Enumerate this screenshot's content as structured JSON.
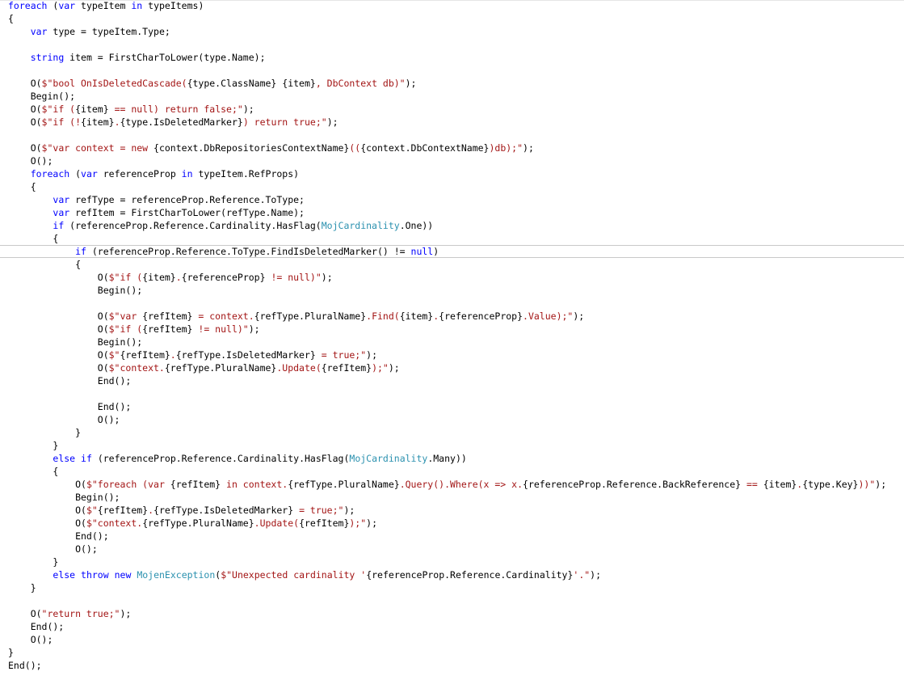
{
  "lines": [
    {
      "tokens": [
        {
          "t": "foreach",
          "c": "kw"
        },
        {
          "t": " (",
          "c": "pl"
        },
        {
          "t": "var",
          "c": "kw"
        },
        {
          "t": " typeItem ",
          "c": "pl"
        },
        {
          "t": "in",
          "c": "kw"
        },
        {
          "t": " typeItems)",
          "c": "pl"
        }
      ]
    },
    {
      "tokens": [
        {
          "t": "{",
          "c": "pl"
        }
      ]
    },
    {
      "tokens": [
        {
          "t": "    ",
          "c": "pl"
        },
        {
          "t": "var",
          "c": "kw"
        },
        {
          "t": " type = typeItem.Type;",
          "c": "pl"
        }
      ]
    },
    {
      "tokens": []
    },
    {
      "tokens": [
        {
          "t": "    ",
          "c": "pl"
        },
        {
          "t": "string",
          "c": "kw"
        },
        {
          "t": " item = FirstCharToLower(type.Name);",
          "c": "pl"
        }
      ]
    },
    {
      "tokens": []
    },
    {
      "tokens": [
        {
          "t": "    O(",
          "c": "pl"
        },
        {
          "t": "$\"bool OnIsDeletedCascade(",
          "c": "str"
        },
        {
          "t": "{type.ClassName}",
          "c": "pl"
        },
        {
          "t": " ",
          "c": "str"
        },
        {
          "t": "{item}",
          "c": "pl"
        },
        {
          "t": ", DbContext db)\"",
          "c": "str"
        },
        {
          "t": ");",
          "c": "pl"
        }
      ]
    },
    {
      "tokens": [
        {
          "t": "    Begin();",
          "c": "pl"
        }
      ]
    },
    {
      "tokens": [
        {
          "t": "    O(",
          "c": "pl"
        },
        {
          "t": "$\"if (",
          "c": "str"
        },
        {
          "t": "{item}",
          "c": "pl"
        },
        {
          "t": " == null) return false;\"",
          "c": "str"
        },
        {
          "t": ");",
          "c": "pl"
        }
      ]
    },
    {
      "tokens": [
        {
          "t": "    O(",
          "c": "pl"
        },
        {
          "t": "$\"if (!",
          "c": "str"
        },
        {
          "t": "{item}",
          "c": "pl"
        },
        {
          "t": ".",
          "c": "str"
        },
        {
          "t": "{type.IsDeletedMarker}",
          "c": "pl"
        },
        {
          "t": ") return true;\"",
          "c": "str"
        },
        {
          "t": ");",
          "c": "pl"
        }
      ]
    },
    {
      "tokens": []
    },
    {
      "tokens": [
        {
          "t": "    O(",
          "c": "pl"
        },
        {
          "t": "$\"var context = new ",
          "c": "str"
        },
        {
          "t": "{context.DbRepositoriesContextName}",
          "c": "pl"
        },
        {
          "t": "((",
          "c": "str"
        },
        {
          "t": "{context.DbContextName}",
          "c": "pl"
        },
        {
          "t": ")db);\"",
          "c": "str"
        },
        {
          "t": ");",
          "c": "pl"
        }
      ]
    },
    {
      "tokens": [
        {
          "t": "    O();",
          "c": "pl"
        }
      ]
    },
    {
      "tokens": [
        {
          "t": "    ",
          "c": "pl"
        },
        {
          "t": "foreach",
          "c": "kw"
        },
        {
          "t": " (",
          "c": "pl"
        },
        {
          "t": "var",
          "c": "kw"
        },
        {
          "t": " referenceProp ",
          "c": "pl"
        },
        {
          "t": "in",
          "c": "kw"
        },
        {
          "t": " typeItem.RefProps)",
          "c": "pl"
        }
      ]
    },
    {
      "tokens": [
        {
          "t": "    {",
          "c": "pl"
        }
      ]
    },
    {
      "tokens": [
        {
          "t": "        ",
          "c": "pl"
        },
        {
          "t": "var",
          "c": "kw"
        },
        {
          "t": " refType = referenceProp.Reference.ToType;",
          "c": "pl"
        }
      ]
    },
    {
      "tokens": [
        {
          "t": "        ",
          "c": "pl"
        },
        {
          "t": "var",
          "c": "kw"
        },
        {
          "t": " refItem = FirstCharToLower(refType.Name);",
          "c": "pl"
        }
      ]
    },
    {
      "tokens": [
        {
          "t": "        ",
          "c": "pl"
        },
        {
          "t": "if",
          "c": "kw"
        },
        {
          "t": " (referenceProp.Reference.Cardinality.HasFlag(",
          "c": "pl"
        },
        {
          "t": "MojCardinality",
          "c": "type"
        },
        {
          "t": ".One))",
          "c": "pl"
        }
      ]
    },
    {
      "tokens": [
        {
          "t": "        {",
          "c": "pl"
        }
      ]
    },
    {
      "tokens": [
        {
          "t": "            ",
          "c": "pl"
        },
        {
          "t": "if",
          "c": "kw"
        },
        {
          "t": " (referenceProp.Reference.ToType.FindIsDeletedMarker() != ",
          "c": "pl"
        },
        {
          "t": "null",
          "c": "kw"
        },
        {
          "t": ")",
          "c": "pl"
        }
      ]
    },
    {
      "tokens": [
        {
          "t": "            {",
          "c": "pl"
        }
      ]
    },
    {
      "tokens": [
        {
          "t": "                O(",
          "c": "pl"
        },
        {
          "t": "$\"if (",
          "c": "str"
        },
        {
          "t": "{item}",
          "c": "pl"
        },
        {
          "t": ".",
          "c": "str"
        },
        {
          "t": "{referenceProp}",
          "c": "pl"
        },
        {
          "t": " != null)\"",
          "c": "str"
        },
        {
          "t": ");",
          "c": "pl"
        }
      ]
    },
    {
      "tokens": [
        {
          "t": "                Begin();",
          "c": "pl"
        }
      ]
    },
    {
      "tokens": []
    },
    {
      "tokens": [
        {
          "t": "                O(",
          "c": "pl"
        },
        {
          "t": "$\"var ",
          "c": "str"
        },
        {
          "t": "{refItem}",
          "c": "pl"
        },
        {
          "t": " = context.",
          "c": "str"
        },
        {
          "t": "{refType.PluralName}",
          "c": "pl"
        },
        {
          "t": ".Find(",
          "c": "str"
        },
        {
          "t": "{item}",
          "c": "pl"
        },
        {
          "t": ".",
          "c": "str"
        },
        {
          "t": "{referenceProp}",
          "c": "pl"
        },
        {
          "t": ".Value);\"",
          "c": "str"
        },
        {
          "t": ");",
          "c": "pl"
        }
      ]
    },
    {
      "tokens": [
        {
          "t": "                O(",
          "c": "pl"
        },
        {
          "t": "$\"if (",
          "c": "str"
        },
        {
          "t": "{refItem}",
          "c": "pl"
        },
        {
          "t": " != null)\"",
          "c": "str"
        },
        {
          "t": ");",
          "c": "pl"
        }
      ]
    },
    {
      "tokens": [
        {
          "t": "                Begin();",
          "c": "pl"
        }
      ]
    },
    {
      "tokens": [
        {
          "t": "                O(",
          "c": "pl"
        },
        {
          "t": "$\"",
          "c": "str"
        },
        {
          "t": "{refItem}",
          "c": "pl"
        },
        {
          "t": ".",
          "c": "str"
        },
        {
          "t": "{refType.IsDeletedMarker}",
          "c": "pl"
        },
        {
          "t": " = true;\"",
          "c": "str"
        },
        {
          "t": ");",
          "c": "pl"
        }
      ]
    },
    {
      "tokens": [
        {
          "t": "                O(",
          "c": "pl"
        },
        {
          "t": "$\"context.",
          "c": "str"
        },
        {
          "t": "{refType.PluralName}",
          "c": "pl"
        },
        {
          "t": ".Update(",
          "c": "str"
        },
        {
          "t": "{refItem}",
          "c": "pl"
        },
        {
          "t": ");\"",
          "c": "str"
        },
        {
          "t": ");",
          "c": "pl"
        }
      ]
    },
    {
      "tokens": [
        {
          "t": "                End();",
          "c": "pl"
        }
      ]
    },
    {
      "tokens": []
    },
    {
      "tokens": [
        {
          "t": "                End();",
          "c": "pl"
        }
      ]
    },
    {
      "tokens": [
        {
          "t": "                O();",
          "c": "pl"
        }
      ]
    },
    {
      "tokens": [
        {
          "t": "            }",
          "c": "pl"
        }
      ]
    },
    {
      "tokens": [
        {
          "t": "        }",
          "c": "pl"
        }
      ]
    },
    {
      "tokens": [
        {
          "t": "        ",
          "c": "pl"
        },
        {
          "t": "else",
          "c": "kw"
        },
        {
          "t": " ",
          "c": "pl"
        },
        {
          "t": "if",
          "c": "kw"
        },
        {
          "t": " (referenceProp.Reference.Cardinality.HasFlag(",
          "c": "pl"
        },
        {
          "t": "MojCardinality",
          "c": "type"
        },
        {
          "t": ".Many))",
          "c": "pl"
        }
      ]
    },
    {
      "tokens": [
        {
          "t": "        {",
          "c": "pl"
        }
      ]
    },
    {
      "tokens": [
        {
          "t": "            O(",
          "c": "pl"
        },
        {
          "t": "$\"foreach (var ",
          "c": "str"
        },
        {
          "t": "{refItem}",
          "c": "pl"
        },
        {
          "t": " in context.",
          "c": "str"
        },
        {
          "t": "{refType.PluralName}",
          "c": "pl"
        },
        {
          "t": ".Query().Where(x => x.",
          "c": "str"
        },
        {
          "t": "{referenceProp.Reference.BackReference}",
          "c": "pl"
        },
        {
          "t": " == ",
          "c": "str"
        },
        {
          "t": "{item}",
          "c": "pl"
        },
        {
          "t": ".",
          "c": "str"
        },
        {
          "t": "{type.Key}",
          "c": "pl"
        },
        {
          "t": "))\"",
          "c": "str"
        },
        {
          "t": ");",
          "c": "pl"
        }
      ]
    },
    {
      "tokens": [
        {
          "t": "            Begin();",
          "c": "pl"
        }
      ]
    },
    {
      "tokens": [
        {
          "t": "            O(",
          "c": "pl"
        },
        {
          "t": "$\"",
          "c": "str"
        },
        {
          "t": "{refItem}",
          "c": "pl"
        },
        {
          "t": ".",
          "c": "str"
        },
        {
          "t": "{refType.IsDeletedMarker}",
          "c": "pl"
        },
        {
          "t": " = true;\"",
          "c": "str"
        },
        {
          "t": ");",
          "c": "pl"
        }
      ]
    },
    {
      "tokens": [
        {
          "t": "            O(",
          "c": "pl"
        },
        {
          "t": "$\"context.",
          "c": "str"
        },
        {
          "t": "{refType.PluralName}",
          "c": "pl"
        },
        {
          "t": ".Update(",
          "c": "str"
        },
        {
          "t": "{refItem}",
          "c": "pl"
        },
        {
          "t": ");\"",
          "c": "str"
        },
        {
          "t": ");",
          "c": "pl"
        }
      ]
    },
    {
      "tokens": [
        {
          "t": "            End();",
          "c": "pl"
        }
      ]
    },
    {
      "tokens": [
        {
          "t": "            O();",
          "c": "pl"
        }
      ]
    },
    {
      "tokens": [
        {
          "t": "        }",
          "c": "pl"
        }
      ]
    },
    {
      "tokens": [
        {
          "t": "        ",
          "c": "pl"
        },
        {
          "t": "else",
          "c": "kw"
        },
        {
          "t": " ",
          "c": "pl"
        },
        {
          "t": "throw",
          "c": "kw"
        },
        {
          "t": " ",
          "c": "pl"
        },
        {
          "t": "new",
          "c": "kw"
        },
        {
          "t": " ",
          "c": "pl"
        },
        {
          "t": "MojenException",
          "c": "type"
        },
        {
          "t": "(",
          "c": "pl"
        },
        {
          "t": "$\"Unexpected cardinality '",
          "c": "str"
        },
        {
          "t": "{referenceProp.Reference.Cardinality}",
          "c": "pl"
        },
        {
          "t": "'.\"",
          "c": "str"
        },
        {
          "t": ");",
          "c": "pl"
        }
      ]
    },
    {
      "tokens": [
        {
          "t": "    }",
          "c": "pl"
        }
      ]
    },
    {
      "tokens": []
    },
    {
      "tokens": [
        {
          "t": "    O(",
          "c": "pl"
        },
        {
          "t": "\"return true;\"",
          "c": "str"
        },
        {
          "t": ");",
          "c": "pl"
        }
      ]
    },
    {
      "tokens": [
        {
          "t": "    End();",
          "c": "pl"
        }
      ]
    },
    {
      "tokens": [
        {
          "t": "    O();",
          "c": "pl"
        }
      ]
    },
    {
      "tokens": [
        {
          "t": "}",
          "c": "pl"
        }
      ]
    },
    {
      "tokens": [
        {
          "t": "End();",
          "c": "pl"
        }
      ]
    }
  ]
}
